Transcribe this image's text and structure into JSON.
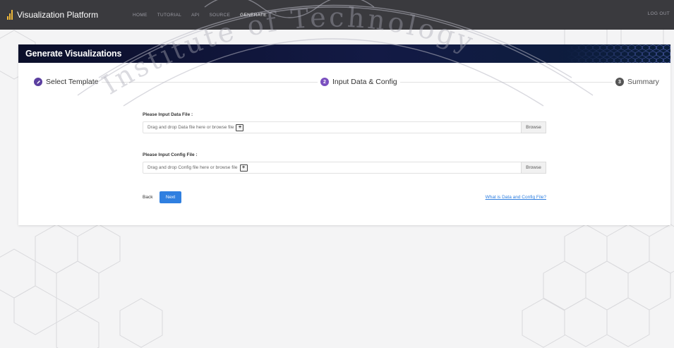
{
  "navbar": {
    "brand": "Visualization Platform",
    "brand_icon": "bar-chart-icon",
    "links": [
      "HOME",
      "TUTORIAL",
      "API",
      "SOURCE",
      "GENERATE"
    ],
    "active": "GENERATE",
    "logout": "LOG OUT"
  },
  "card": {
    "title": "Generate Visualizations"
  },
  "stepper": {
    "steps": [
      {
        "label": "Select Template",
        "state": "done",
        "icon": "pencil-icon"
      },
      {
        "label": "Input Data & Config",
        "state": "active",
        "number": "2"
      },
      {
        "label": "Summary",
        "state": "pending",
        "number": "3"
      }
    ]
  },
  "form": {
    "data_file": {
      "label": "Please Input Data File :",
      "placeholder": "Drag and drop Data file here or browse file",
      "browse": "Browse"
    },
    "config_file": {
      "label": "Please Input Config File :",
      "placeholder": "Drag and drop Config file here or browse file",
      "browse": "Browse"
    },
    "back": "Back",
    "next": "Next",
    "help": "What is Data and Config File?"
  },
  "watermark": {
    "text": "Institute of Technology"
  },
  "colors": {
    "navbar": "#3a3a3e",
    "header": "#131a45",
    "accent": "#2f7fe0",
    "step_active": "#7a4fbf"
  }
}
